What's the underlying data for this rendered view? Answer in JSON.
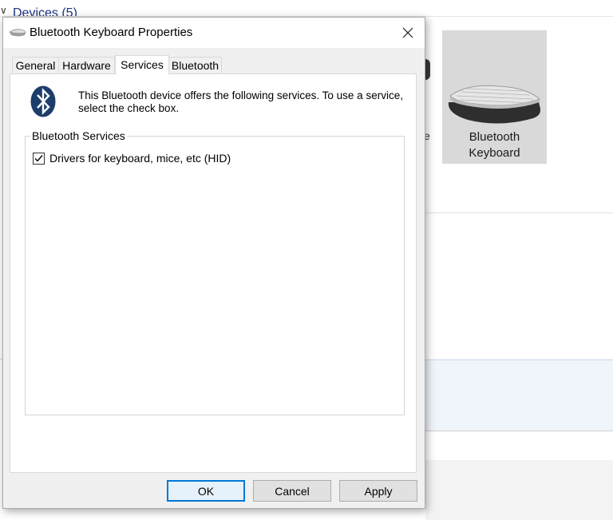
{
  "background": {
    "group_header": "Devices (5)",
    "device_tile_label": "Bluetooth Keyboard",
    "partial_char": "e"
  },
  "dialog": {
    "title": "Bluetooth Keyboard Properties",
    "tabs": [
      {
        "label": "General"
      },
      {
        "label": "Hardware"
      },
      {
        "label": "Services",
        "active": true
      },
      {
        "label": "Bluetooth"
      }
    ],
    "description": "This Bluetooth device offers the following services. To use a service, select the check box.",
    "services_group_label": "Bluetooth Services",
    "services": [
      {
        "label": "Drivers for keyboard, mice, etc (HID)",
        "checked": true
      }
    ],
    "buttons": {
      "ok": "OK",
      "cancel": "Cancel",
      "apply": "Apply"
    }
  },
  "colors": {
    "accent": "#0078d7",
    "bluetooth_logo": "#1d3d6c",
    "link_blue": "#1e3287"
  },
  "icons": {
    "title_icon": "keyboard-icon",
    "close": "close-icon",
    "bluetooth": "bluetooth-icon",
    "check": "checkmark-icon"
  }
}
